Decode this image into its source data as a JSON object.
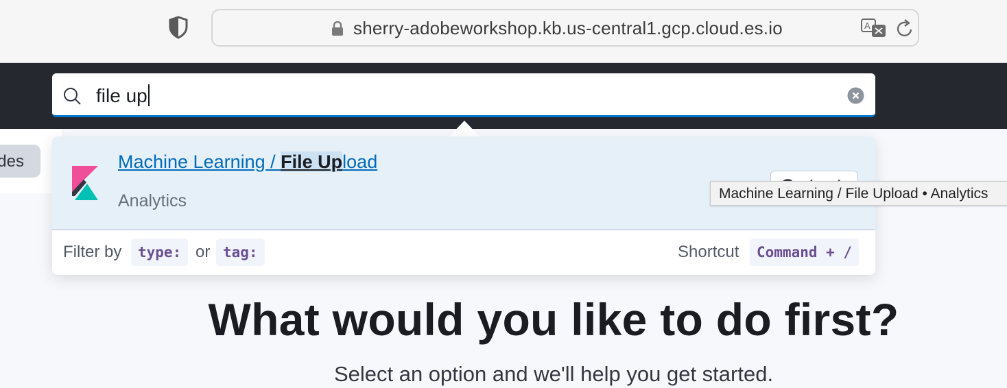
{
  "browser": {
    "url": "sherry-adobeworkshop.kb.us-central1.gcp.cloud.es.io",
    "icons": [
      "shield-icon",
      "lock-icon",
      "translate-icon",
      "reload-icon"
    ]
  },
  "search": {
    "value": "file up",
    "icons": [
      "search-icon",
      "clear-icon"
    ]
  },
  "results": [
    {
      "title_prefix": "Machine Learning / ",
      "title_match": "File Up",
      "title_suffix": "load",
      "meta": "Analytics",
      "action_label": "Go to ↵",
      "icon": "kibana-logo-icon"
    }
  ],
  "footer": {
    "filter_by": "Filter by",
    "type_chip": "type:",
    "or": "or",
    "tag_chip": "tag:",
    "shortcut_label": "Shortcut",
    "shortcut_keys": "Command + /"
  },
  "tooltip": {
    "text": "Machine Learning / File Upload • Analytics"
  },
  "sidebar": {
    "guides_label": "des"
  },
  "hero": {
    "title": "What would you like to do first?",
    "subtitle": "Select an option and we'll help you get started."
  },
  "colors": {
    "header_bg": "#25282f",
    "accent": "#0077cc",
    "link": "#006bb8",
    "row_highlight": "#e6f0f8",
    "chip_text": "#6a4f92"
  }
}
